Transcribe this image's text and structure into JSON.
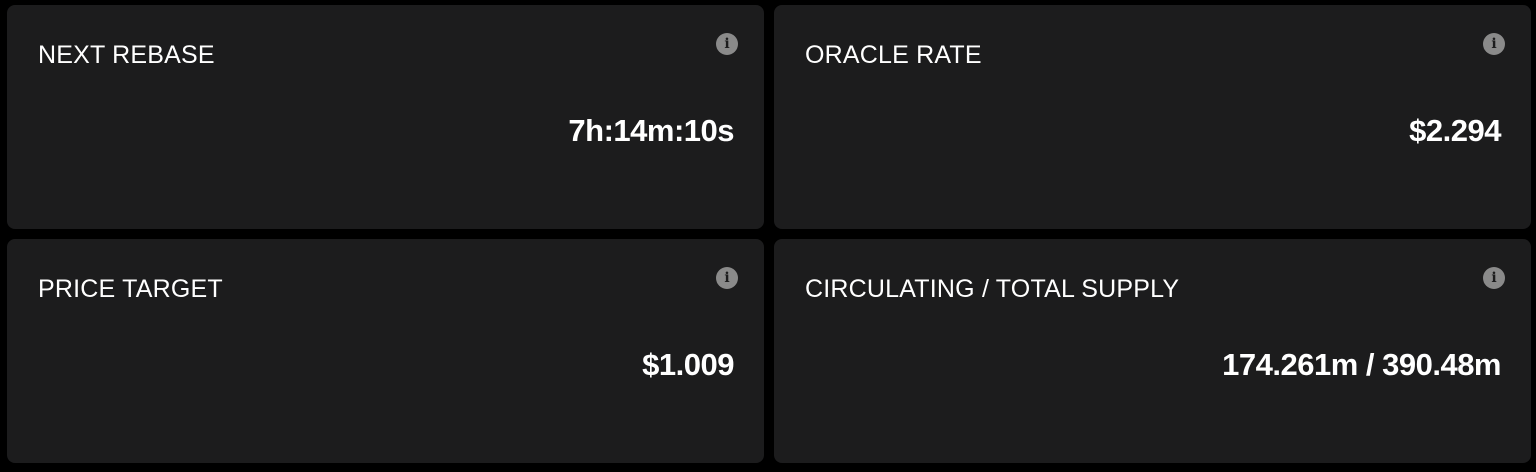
{
  "cards": [
    {
      "title": "NEXT REBASE",
      "value": "7h:14m:10s",
      "info_icon": "info-circle"
    },
    {
      "title": "ORACLE RATE",
      "value": "$2.294",
      "info_icon": "info-circle"
    },
    {
      "title": "PRICE TARGET",
      "value": "$1.009",
      "info_icon": "info-circle"
    },
    {
      "title": "CIRCULATING / TOTAL SUPPLY",
      "value": "174.261m / 390.48m",
      "info_icon": "info-circle"
    }
  ],
  "colors": {
    "background": "#000000",
    "card": "#1c1c1d",
    "text": "#ffffff",
    "icon": "#8a8a8a"
  }
}
